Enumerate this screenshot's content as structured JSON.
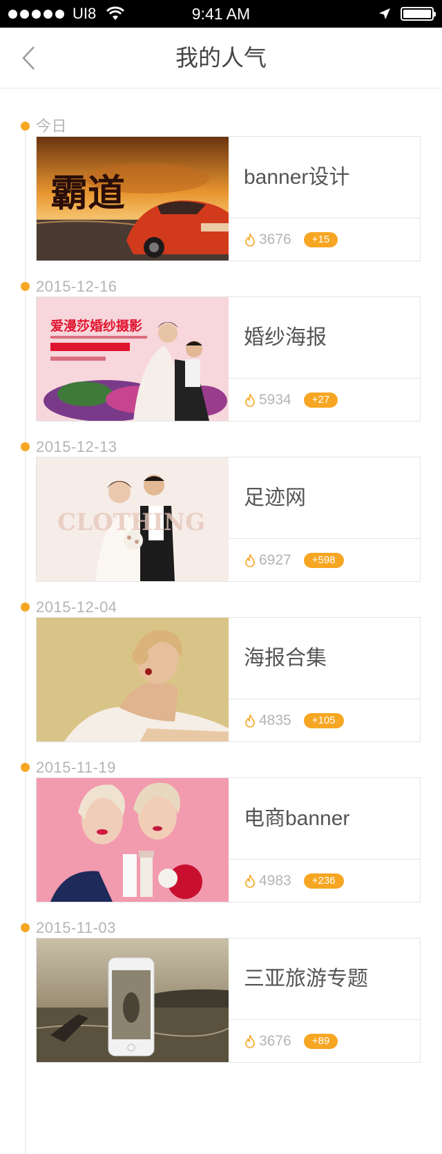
{
  "status_bar": {
    "carrier": "UI8",
    "time": "9:41 AM"
  },
  "nav": {
    "title": "我的人气",
    "back_icon": "chevron-left-icon"
  },
  "colors": {
    "accent": "#f6a623",
    "date_text": "#b4b4b4",
    "title_text": "#555555",
    "divider": "#e4e4e4"
  },
  "entries": [
    {
      "date": "今日",
      "title": "banner设计",
      "count": "3676",
      "badge": "+15",
      "image": "sports-car-sunset-poster",
      "image_text": "霸道"
    },
    {
      "date": "2015-12-16",
      "title": "婚纱海报",
      "count": "5934",
      "badge": "+27",
      "image": "wedding-couple-pink-poster",
      "image_text": "爱漫莎婚纱摄影"
    },
    {
      "date": "2015-12-13",
      "title": "足迹网",
      "count": "6927",
      "badge": "+598",
      "image": "wedding-couple-clothing",
      "image_text": "CLOTHING"
    },
    {
      "date": "2015-12-04",
      "title": "海报合集",
      "count": "4835",
      "badge": "+105",
      "image": "vintage-woman-portrait"
    },
    {
      "date": "2015-11-19",
      "title": "电商banner",
      "count": "4983",
      "badge": "+236",
      "image": "cosmetics-models-pink"
    },
    {
      "date": "2015-11-03",
      "title": "三亚旅游专题",
      "count": "3676",
      "badge": "+89",
      "image": "phone-sea-travel"
    }
  ]
}
